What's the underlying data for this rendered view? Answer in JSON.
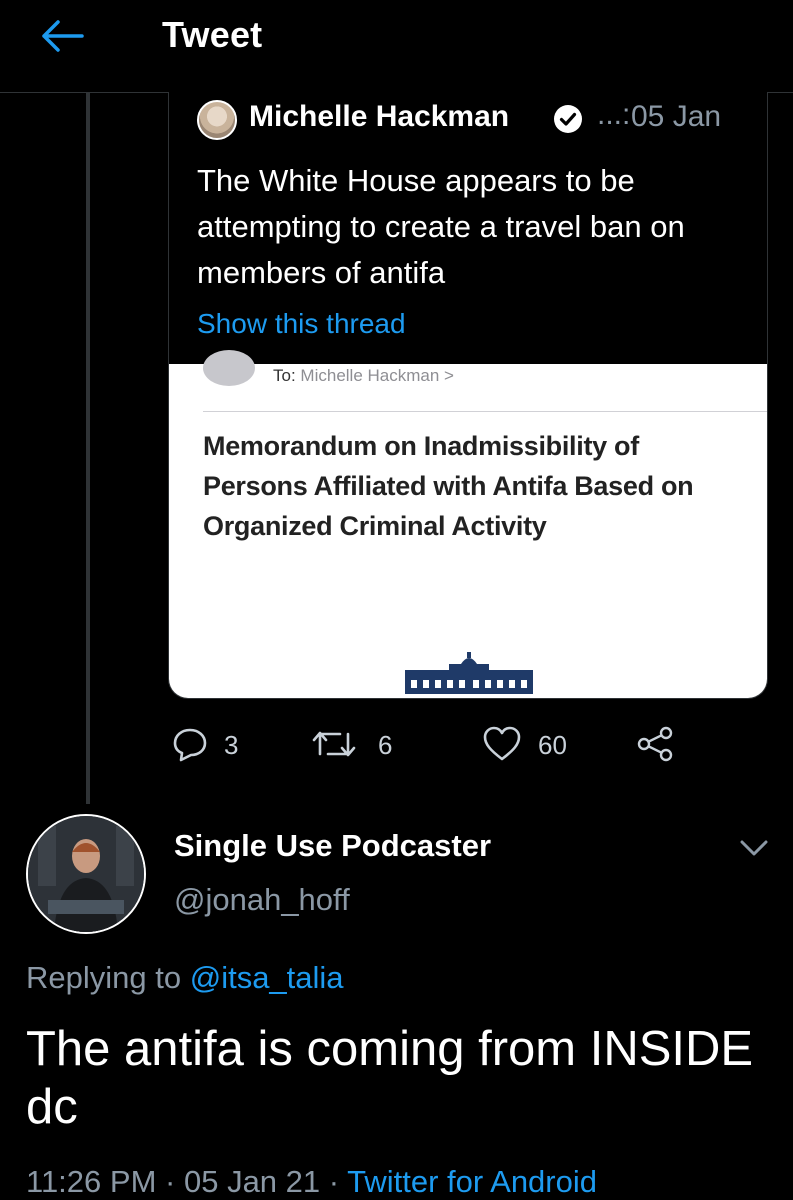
{
  "header": {
    "title": "Tweet",
    "back_icon": "arrow-left-icon"
  },
  "quoted_tweet": {
    "author_name": "Michelle Hackman",
    "separator": "...:",
    "date": "05 Jan",
    "text": "The White House appears to be attempting to create a travel ban on members of antifa",
    "show_thread": "Show this thread",
    "memo": {
      "to_label": "To:",
      "to_name": "Michelle Hackman",
      "to_chevron": ">",
      "title": "Memorandum on Inadmissibility of Persons Affiliated with Antifa Based on Organized Criminal Activity"
    }
  },
  "actions": {
    "reply_count": "3",
    "retweet_count": "6",
    "like_count": "60"
  },
  "main_tweet": {
    "author_name": "Single Use Podcaster",
    "author_handle": "@jonah_hoff",
    "replying_to_prefix": "Replying to",
    "replying_to_handle": "@itsa_talia",
    "text": "The antifa is coming from INSIDE dc",
    "time": "11:26 PM",
    "dot": "·",
    "date": "05 Jan 21",
    "source": "Twitter for Android"
  },
  "colors": {
    "background": "#000000",
    "accent": "#1d9bf0",
    "secondary_text": "#8b98a5",
    "divider": "#2f3336"
  }
}
